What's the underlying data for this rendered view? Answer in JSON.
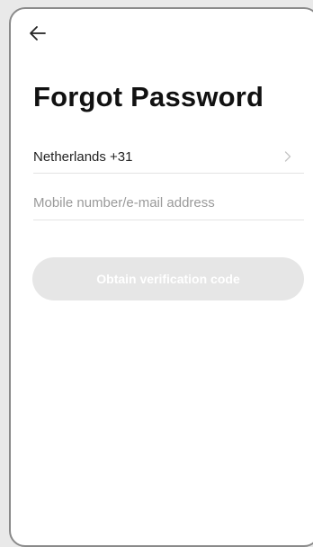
{
  "header": {
    "back_icon": "arrow-left-icon"
  },
  "page": {
    "title": "Forgot Password"
  },
  "country": {
    "label": "Netherlands +31",
    "icon": "chevron-right-icon"
  },
  "account_input": {
    "value": "",
    "placeholder": "Mobile number/e-mail address"
  },
  "actions": {
    "obtain_code_label": "Obtain verification code",
    "disabled_bg": "#e6e6e6",
    "disabled_text": "#ffffff"
  }
}
